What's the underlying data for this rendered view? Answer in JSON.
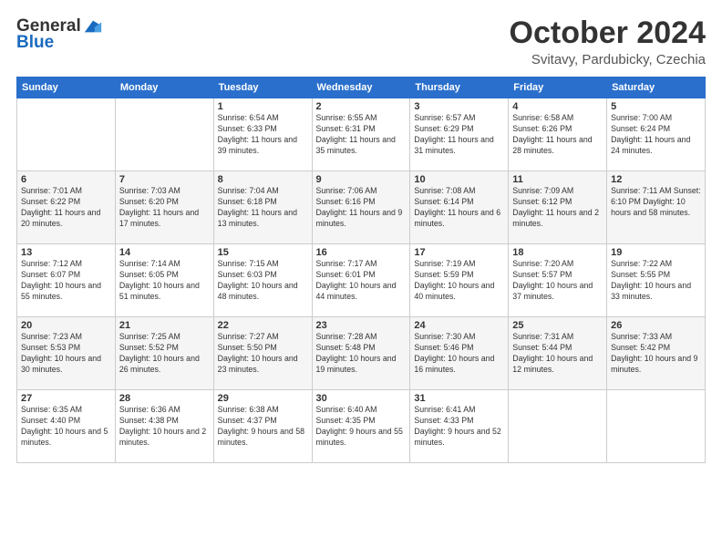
{
  "header": {
    "logo_line1": "General",
    "logo_line2": "Blue",
    "month_title": "October 2024",
    "location": "Svitavy, Pardubicky, Czechia"
  },
  "weekdays": [
    "Sunday",
    "Monday",
    "Tuesday",
    "Wednesday",
    "Thursday",
    "Friday",
    "Saturday"
  ],
  "weeks": [
    [
      {
        "day": "",
        "info": ""
      },
      {
        "day": "",
        "info": ""
      },
      {
        "day": "1",
        "info": "Sunrise: 6:54 AM\nSunset: 6:33 PM\nDaylight: 11 hours and 39 minutes."
      },
      {
        "day": "2",
        "info": "Sunrise: 6:55 AM\nSunset: 6:31 PM\nDaylight: 11 hours and 35 minutes."
      },
      {
        "day": "3",
        "info": "Sunrise: 6:57 AM\nSunset: 6:29 PM\nDaylight: 11 hours and 31 minutes."
      },
      {
        "day": "4",
        "info": "Sunrise: 6:58 AM\nSunset: 6:26 PM\nDaylight: 11 hours and 28 minutes."
      },
      {
        "day": "5",
        "info": "Sunrise: 7:00 AM\nSunset: 6:24 PM\nDaylight: 11 hours and 24 minutes."
      }
    ],
    [
      {
        "day": "6",
        "info": "Sunrise: 7:01 AM\nSunset: 6:22 PM\nDaylight: 11 hours and 20 minutes."
      },
      {
        "day": "7",
        "info": "Sunrise: 7:03 AM\nSunset: 6:20 PM\nDaylight: 11 hours and 17 minutes."
      },
      {
        "day": "8",
        "info": "Sunrise: 7:04 AM\nSunset: 6:18 PM\nDaylight: 11 hours and 13 minutes."
      },
      {
        "day": "9",
        "info": "Sunrise: 7:06 AM\nSunset: 6:16 PM\nDaylight: 11 hours and 9 minutes."
      },
      {
        "day": "10",
        "info": "Sunrise: 7:08 AM\nSunset: 6:14 PM\nDaylight: 11 hours and 6 minutes."
      },
      {
        "day": "11",
        "info": "Sunrise: 7:09 AM\nSunset: 6:12 PM\nDaylight: 11 hours and 2 minutes."
      },
      {
        "day": "12",
        "info": "Sunrise: 7:11 AM\nSunset: 6:10 PM\nDaylight: 10 hours and 58 minutes."
      }
    ],
    [
      {
        "day": "13",
        "info": "Sunrise: 7:12 AM\nSunset: 6:07 PM\nDaylight: 10 hours and 55 minutes."
      },
      {
        "day": "14",
        "info": "Sunrise: 7:14 AM\nSunset: 6:05 PM\nDaylight: 10 hours and 51 minutes."
      },
      {
        "day": "15",
        "info": "Sunrise: 7:15 AM\nSunset: 6:03 PM\nDaylight: 10 hours and 48 minutes."
      },
      {
        "day": "16",
        "info": "Sunrise: 7:17 AM\nSunset: 6:01 PM\nDaylight: 10 hours and 44 minutes."
      },
      {
        "day": "17",
        "info": "Sunrise: 7:19 AM\nSunset: 5:59 PM\nDaylight: 10 hours and 40 minutes."
      },
      {
        "day": "18",
        "info": "Sunrise: 7:20 AM\nSunset: 5:57 PM\nDaylight: 10 hours and 37 minutes."
      },
      {
        "day": "19",
        "info": "Sunrise: 7:22 AM\nSunset: 5:55 PM\nDaylight: 10 hours and 33 minutes."
      }
    ],
    [
      {
        "day": "20",
        "info": "Sunrise: 7:23 AM\nSunset: 5:53 PM\nDaylight: 10 hours and 30 minutes."
      },
      {
        "day": "21",
        "info": "Sunrise: 7:25 AM\nSunset: 5:52 PM\nDaylight: 10 hours and 26 minutes."
      },
      {
        "day": "22",
        "info": "Sunrise: 7:27 AM\nSunset: 5:50 PM\nDaylight: 10 hours and 23 minutes."
      },
      {
        "day": "23",
        "info": "Sunrise: 7:28 AM\nSunset: 5:48 PM\nDaylight: 10 hours and 19 minutes."
      },
      {
        "day": "24",
        "info": "Sunrise: 7:30 AM\nSunset: 5:46 PM\nDaylight: 10 hours and 16 minutes."
      },
      {
        "day": "25",
        "info": "Sunrise: 7:31 AM\nSunset: 5:44 PM\nDaylight: 10 hours and 12 minutes."
      },
      {
        "day": "26",
        "info": "Sunrise: 7:33 AM\nSunset: 5:42 PM\nDaylight: 10 hours and 9 minutes."
      }
    ],
    [
      {
        "day": "27",
        "info": "Sunrise: 6:35 AM\nSunset: 4:40 PM\nDaylight: 10 hours and 5 minutes."
      },
      {
        "day": "28",
        "info": "Sunrise: 6:36 AM\nSunset: 4:38 PM\nDaylight: 10 hours and 2 minutes."
      },
      {
        "day": "29",
        "info": "Sunrise: 6:38 AM\nSunset: 4:37 PM\nDaylight: 9 hours and 58 minutes."
      },
      {
        "day": "30",
        "info": "Sunrise: 6:40 AM\nSunset: 4:35 PM\nDaylight: 9 hours and 55 minutes."
      },
      {
        "day": "31",
        "info": "Sunrise: 6:41 AM\nSunset: 4:33 PM\nDaylight: 9 hours and 52 minutes."
      },
      {
        "day": "",
        "info": ""
      },
      {
        "day": "",
        "info": ""
      }
    ]
  ]
}
